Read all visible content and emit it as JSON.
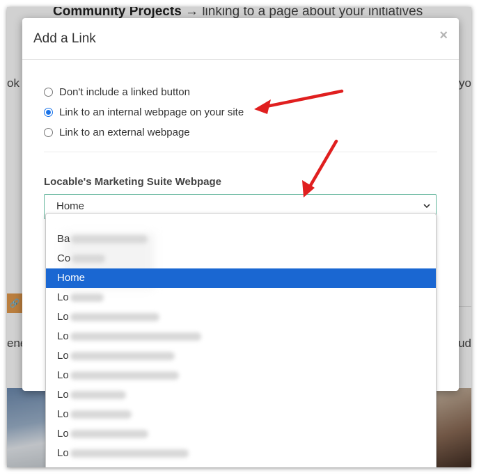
{
  "background": {
    "heading_bold": "Community Projects",
    "heading_rest": " → linking to a page about your initiatives",
    "left_fragment_1": "ok",
    "right_fragment_1": "yo",
    "left_fragment_2": "ene",
    "right_fragment_2": "ud",
    "link_icon": "link-icon"
  },
  "modal": {
    "title": "Add a Link",
    "close": "×",
    "options": [
      {
        "label": "Don't include a linked button",
        "checked": false
      },
      {
        "label": "Link to an internal webpage on your site",
        "checked": true
      },
      {
        "label": "Link to an external webpage",
        "checked": false
      }
    ],
    "field_label": "Locable's Marketing Suite Webpage",
    "select_value": "Home"
  },
  "dropdown": {
    "options": [
      {
        "text": "Ba",
        "blurred": true
      },
      {
        "text": "Co",
        "blurred": true
      },
      {
        "text": "Home",
        "blurred": false,
        "selected": true
      },
      {
        "text": "Lo",
        "blurred": true
      },
      {
        "text": "Lo",
        "blurred": true
      },
      {
        "text": "Lo",
        "blurred": true
      },
      {
        "text": "Lo",
        "blurred": true
      },
      {
        "text": "Lo",
        "blurred": true
      },
      {
        "text": "Lo",
        "blurred": true
      },
      {
        "text": "Lo",
        "blurred": true
      },
      {
        "text": "Lo",
        "blurred": true
      },
      {
        "text": "Lo",
        "blurred": true
      }
    ]
  },
  "colors": {
    "accent_blue": "#1a67d2",
    "select_border": "#63b59c",
    "annotation_red": "#e01f1f"
  }
}
